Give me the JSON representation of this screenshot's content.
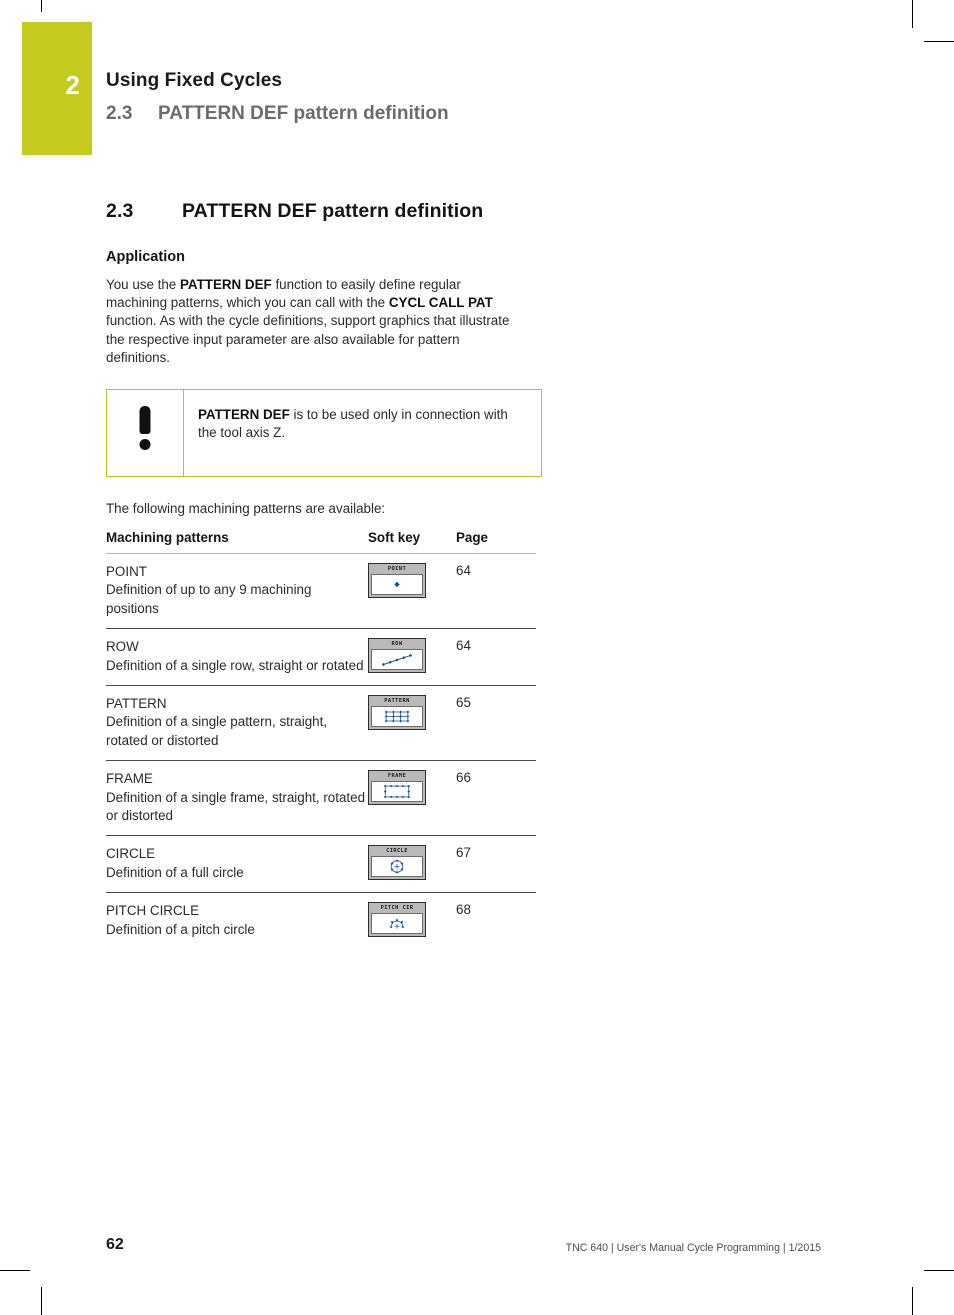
{
  "header": {
    "chapter_number": "2",
    "chapter_title": "Using Fixed Cycles",
    "section_number": "2.3",
    "section_title": "PATTERN DEF pattern definition",
    "tab_color": "#c3cc1e"
  },
  "main": {
    "section_number": "2.3",
    "section_title": "PATTERN DEF pattern definition",
    "application_heading": "Application",
    "paragraph": {
      "part1": "You use the ",
      "bold1": "PATTERN DEF",
      "part2": " function to easily define regular machining patterns, which you can call with the ",
      "bold2": "CYCL CALL PAT",
      "part3": " function. As with the cycle definitions, support graphics that illustrate the respective input parameter are also available for pattern definitions."
    },
    "note": {
      "icon": "exclamation-icon",
      "bold": "PATTERN DEF",
      "text": " is to be used only in connection with the tool axis Z.",
      "border_color": "#b8bf20"
    },
    "table_intro": "The following machining patterns are available:",
    "table": {
      "headers": [
        "Machining patterns",
        "Soft key",
        "Page"
      ],
      "rows": [
        {
          "title": "POINT",
          "desc": "Definition of up to any 9 machining positions",
          "softkey_label": "POINT",
          "softkey_icon": "point-pattern-icon",
          "page": "64"
        },
        {
          "title": "ROW",
          "desc": "Definition of a single row, straight or rotated",
          "softkey_label": "ROW",
          "softkey_icon": "row-pattern-icon",
          "page": "64"
        },
        {
          "title": "PATTERN",
          "desc": "Definition of a single pattern, straight, rotated or distorted",
          "softkey_label": "PATTERN",
          "softkey_icon": "grid-pattern-icon",
          "page": "65"
        },
        {
          "title": "FRAME",
          "desc": "Definition of a single frame, straight, rotated or distorted",
          "softkey_label": "FRAME",
          "softkey_icon": "frame-pattern-icon",
          "page": "66"
        },
        {
          "title": "CIRCLE",
          "desc": "Definition of a full circle",
          "softkey_label": "CIRCLE",
          "softkey_icon": "circle-pattern-icon",
          "page": "67"
        },
        {
          "title": "PITCH CIRCLE",
          "desc": "Definition of a pitch circle",
          "softkey_label": "PITCH CIR",
          "softkey_icon": "pitch-circle-pattern-icon",
          "page": "68"
        }
      ]
    }
  },
  "footer": {
    "page_number": "62",
    "meta": "TNC 640 | User's Manual Cycle Programming | 1/2015"
  }
}
